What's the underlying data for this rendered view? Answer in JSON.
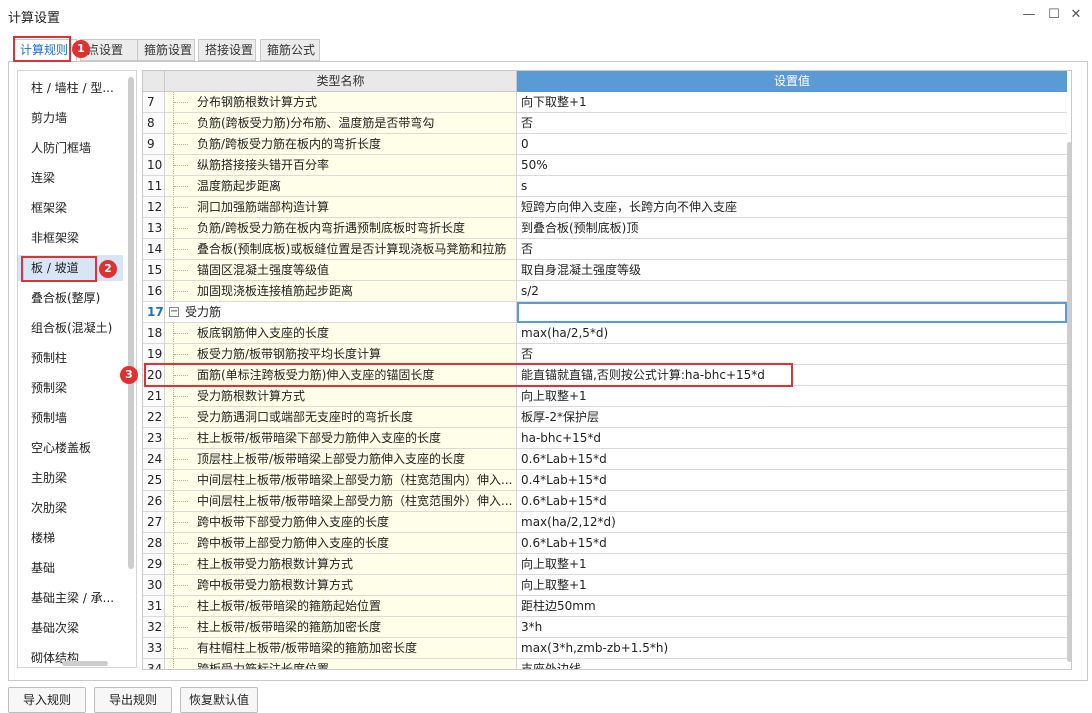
{
  "window": {
    "title": "计算设置",
    "min_icon": "minimize-icon",
    "max_icon": "maximize-icon",
    "close_icon": "close-icon"
  },
  "tabs": [
    {
      "label": "计算规则",
      "active": true
    },
    {
      "label": "点设置",
      "active": false
    },
    {
      "label": "箍筋设置",
      "active": false
    },
    {
      "label": "搭接设置",
      "active": false
    },
    {
      "label": "箍筋公式",
      "active": false
    }
  ],
  "sidebar": {
    "items": [
      {
        "label": "柱 / 墙柱 / 型..."
      },
      {
        "label": "剪力墙"
      },
      {
        "label": "人防门框墙"
      },
      {
        "label": "连梁"
      },
      {
        "label": "框架梁"
      },
      {
        "label": "非框架梁"
      },
      {
        "label": "板 / 坡道",
        "selected": true
      },
      {
        "label": "叠合板(整厚)"
      },
      {
        "label": "组合板(混凝土)"
      },
      {
        "label": "预制柱"
      },
      {
        "label": "预制梁"
      },
      {
        "label": "预制墙"
      },
      {
        "label": "空心楼盖板"
      },
      {
        "label": "主肋梁"
      },
      {
        "label": "次肋梁"
      },
      {
        "label": "楼梯"
      },
      {
        "label": "基础"
      },
      {
        "label": "基础主梁 / 承..."
      },
      {
        "label": "基础次梁"
      },
      {
        "label": "砌体结构"
      }
    ]
  },
  "grid": {
    "col_name": "类型名称",
    "col_value": "设置值",
    "rows": [
      {
        "num": "7",
        "name": "分布钢筋根数计算方式",
        "value": "向下取整+1"
      },
      {
        "num": "8",
        "name": "负筋(跨板受力筋)分布筋、温度筋是否带弯勾",
        "value": "否"
      },
      {
        "num": "9",
        "name": "负筋/跨板受力筋在板内的弯折长度",
        "value": "0"
      },
      {
        "num": "10",
        "name": "纵筋搭接接头错开百分率",
        "value": "50%"
      },
      {
        "num": "11",
        "name": "温度筋起步距离",
        "value": "s"
      },
      {
        "num": "12",
        "name": "洞口加强筋端部构造计算",
        "value": "短跨方向伸入支座，长跨方向不伸入支座"
      },
      {
        "num": "13",
        "name": "负筋/跨板受力筋在板内弯折遇预制底板时弯折长度",
        "value": "到叠合板(预制底板)顶"
      },
      {
        "num": "14",
        "name": "叠合板(预制底板)或板缝位置是否计算现浇板马凳筋和拉筋",
        "value": "否"
      },
      {
        "num": "15",
        "name": "锚固区混凝土强度等级值",
        "value": "取自身混凝土强度等级"
      },
      {
        "num": "16",
        "name": "加固现浇板连接植筋起步距离",
        "value": "s/2"
      },
      {
        "num": "17",
        "name": "受力筋",
        "value": "",
        "group": true
      },
      {
        "num": "18",
        "name": "板底钢筋伸入支座的长度",
        "value": "max(ha/2,5*d)"
      },
      {
        "num": "19",
        "name": "板受力筋/板带钢筋按平均长度计算",
        "value": "否"
      },
      {
        "num": "20",
        "name": "面筋(单标注跨板受力筋)伸入支座的锚固长度",
        "value": "能直锚就直锚,否则按公式计算:ha-bhc+15*d"
      },
      {
        "num": "21",
        "name": "受力筋根数计算方式",
        "value": "向上取整+1"
      },
      {
        "num": "22",
        "name": "受力筋遇洞口或端部无支座时的弯折长度",
        "value": "板厚-2*保护层"
      },
      {
        "num": "23",
        "name": "柱上板带/板带暗梁下部受力筋伸入支座的长度",
        "value": "ha-bhc+15*d"
      },
      {
        "num": "24",
        "name": "顶层柱上板带/板带暗梁上部受力筋伸入支座的长度",
        "value": "0.6*Lab+15*d"
      },
      {
        "num": "25",
        "name": "中间层柱上板带/板带暗梁上部受力筋（柱宽范围内）伸入...",
        "value": "0.4*Lab+15*d"
      },
      {
        "num": "26",
        "name": "中间层柱上板带/板带暗梁上部受力筋（柱宽范围外）伸入...",
        "value": "0.6*Lab+15*d"
      },
      {
        "num": "27",
        "name": "跨中板带下部受力筋伸入支座的长度",
        "value": "max(ha/2,12*d)"
      },
      {
        "num": "28",
        "name": "跨中板带上部受力筋伸入支座的长度",
        "value": "0.6*Lab+15*d"
      },
      {
        "num": "29",
        "name": "柱上板带受力筋根数计算方式",
        "value": "向上取整+1"
      },
      {
        "num": "30",
        "name": "跨中板带受力筋根数计算方式",
        "value": "向上取整+1"
      },
      {
        "num": "31",
        "name": "柱上板带/板带暗梁的箍筋起始位置",
        "value": "距柱边50mm"
      },
      {
        "num": "32",
        "name": "柱上板带/板带暗梁的箍筋加密长度",
        "value": "3*h"
      },
      {
        "num": "33",
        "name": "有柱帽柱上板带/板带暗梁的箍筋加密长度",
        "value": "max(3*h,zmb-zb+1.5*h)"
      },
      {
        "num": "34",
        "name": "跨板受力筋标注长度位置",
        "value": "支座外边线"
      }
    ]
  },
  "annotations": [
    {
      "label": "1",
      "color": "#e03030"
    },
    {
      "label": "2",
      "color": "#e03030"
    },
    {
      "label": "3",
      "color": "#e03030"
    }
  ],
  "buttons": {
    "import": "导入规则",
    "export": "导出规则",
    "reset": "恢复默认值"
  }
}
